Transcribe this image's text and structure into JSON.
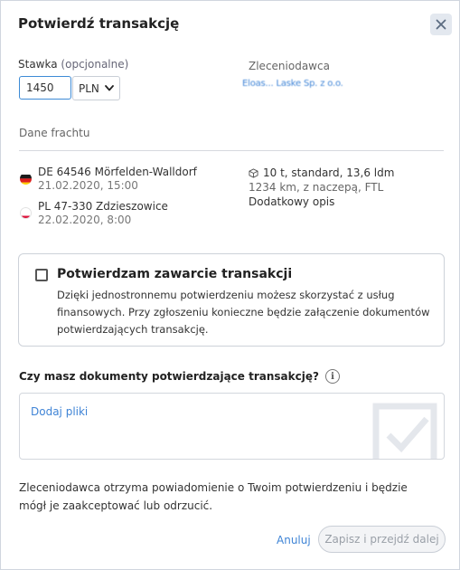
{
  "dialog": {
    "title": "Potwierdź transakcję"
  },
  "rate": {
    "label": "Stawka",
    "optional": "(opcjonalne)",
    "amount": "1450",
    "currency": "PLN"
  },
  "principal": {
    "label": "Zleceniodawca",
    "value": "Eloas... Laske Sp. z o.o."
  },
  "freight": {
    "label": "Dane frachtu",
    "stops": [
      {
        "country": "DE",
        "flag": "germany-flag-icon",
        "address": "DE 64546 Mörfelden-Walldorf",
        "date": "21.02.2020, 15:00"
      },
      {
        "country": "PL",
        "flag": "poland-flag-icon",
        "address": "PL 47-330 Zdzieszowice",
        "date": "22.02.2020, 8:00"
      }
    ],
    "cargo": {
      "icon": "package-icon",
      "summary": "10 t, standard, 13,6 ldm",
      "details": "1234 km, z naczepą, FTL",
      "extra": "Dodatkowy opis"
    }
  },
  "confirm": {
    "title": "Potwierdzam zawarcie transakcji",
    "description": "Dzięki jednostronnemu potwierdzeniu możesz skorzystać z usług finansowych. Przy zgłoszeniu konieczne będzie załączenie dokumentów potwierdzających transakcję.",
    "checked": false
  },
  "documents": {
    "question": "Czy masz dokumenty potwierdzające transakcję?",
    "add_files": "Dodaj pliki"
  },
  "notice": "Zleceniodawca otrzyma powiadomienie o Twoim potwierdzeniu i będzie mógł je zaakceptować lub odrzucić.",
  "actions": {
    "cancel": "Anuluj",
    "save": "Zapisz i przejdź dalej"
  },
  "colors": {
    "accent": "#3f84d6",
    "border": "#cdd2d9",
    "close_bg": "#e3e8ef",
    "disabled_text": "#9aa0a8"
  }
}
